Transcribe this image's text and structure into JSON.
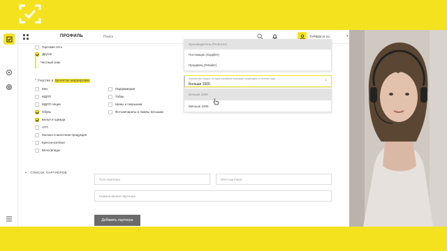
{
  "header": {
    "title": "ПРОФИЛЬ",
    "search_placeholder": "Поиск",
    "user_name": "ТУРКЕВ И. Ю."
  },
  "sales_channels": [
    {
      "label": "Торговая сеть",
      "checked": false
    },
    {
      "label": "Другое",
      "checked": true
    }
  ],
  "chip_label": "Честный знак",
  "participation": {
    "label_prefix": "* Участие в",
    "label_highlight": "проектах маркировки",
    "col1": [
      {
        "label": "Мех",
        "checked": false
      },
      {
        "label": "МДЛП",
        "checked": false
      },
      {
        "label": "МДЛП опции",
        "checked": false
      },
      {
        "label": "Обувь",
        "checked": true
      },
      {
        "label": "Белье и одежда",
        "checked": true
      },
      {
        "label": "АТП",
        "checked": false
      },
      {
        "label": "Молоко и молочная продукция",
        "checked": false
      },
      {
        "label": "Кресла-коляски",
        "checked": false
      },
      {
        "label": "Велосипеды",
        "checked": false
      }
    ],
    "col2": [
      {
        "label": "Парфюмерия",
        "checked": false
      },
      {
        "label": "Табак",
        "checked": false
      },
      {
        "label": "Шины и покрышки",
        "checked": false
      },
      {
        "label": "Фотоаппараты и лампы вспышки",
        "checked": false
      }
    ]
  },
  "role_dropdown": {
    "items": [
      "Производитель (Producer)",
      "Поставщик (Supplier)",
      "Продавец (Retailer)"
    ]
  },
  "product_count_select": {
    "caption": "Количество товара, которое компания планирует размещать в течение года",
    "value": "Больше 1000",
    "options": [
      "Больше 1000",
      "Меньше 1000"
    ]
  },
  "partners": {
    "section_title": "СПИСОК ПАРТНЕРОВ",
    "gln_placeholder": "GLN партнера",
    "inn_placeholder": "ИНН партнера",
    "name_placeholder": "Наименование партнера",
    "add_button": "Добавить партнера"
  },
  "colors": {
    "accent": "#f5e21f",
    "button": "#6b6b6b"
  }
}
